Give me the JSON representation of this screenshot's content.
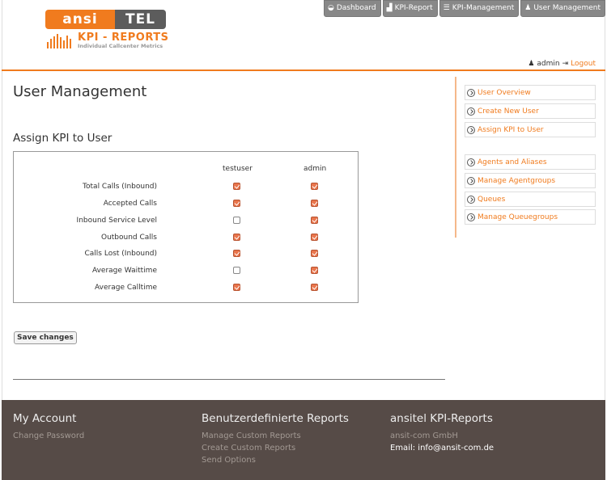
{
  "header": {
    "logo": {
      "ansi": "ansi",
      "tel": "TEL",
      "title": "KPI - REPORTS",
      "subtitle": "Individual Callcenter Metrics"
    },
    "nav": [
      {
        "label": "Dashboard",
        "icon": "dashboard-icon"
      },
      {
        "label": "KPI-Report",
        "icon": "bar-chart-icon"
      },
      {
        "label": "KPI-Management",
        "icon": "list-icon"
      },
      {
        "label": "User Management",
        "icon": "user-icon"
      }
    ],
    "user": {
      "name": "admin",
      "logout": "Logout"
    }
  },
  "main": {
    "title": "User Management",
    "section_title": "Assign KPI to User",
    "columns": [
      "testuser",
      "admin"
    ],
    "rows": [
      {
        "label": "Total Calls (Inbound)",
        "testuser": true,
        "admin": true
      },
      {
        "label": "Accepted Calls",
        "testuser": true,
        "admin": true
      },
      {
        "label": "Inbound Service Level",
        "testuser": false,
        "admin": true
      },
      {
        "label": "Outbound Calls",
        "testuser": true,
        "admin": true
      },
      {
        "label": "Calls Lost (Inbound)",
        "testuser": true,
        "admin": true
      },
      {
        "label": "Average Waittime",
        "testuser": false,
        "admin": true
      },
      {
        "label": "Average Calltime",
        "testuser": true,
        "admin": true
      }
    ],
    "save_label": "Save changes"
  },
  "sidebar": {
    "group1": [
      "User Overview",
      "Create New User",
      "Assign KPI to User"
    ],
    "group2": [
      "Agents and Aliases",
      "Manage Agentgroups",
      "Queues",
      "Manage Queuegroups"
    ]
  },
  "footer": {
    "col1": {
      "title": "My Account",
      "links": [
        "Change Password"
      ]
    },
    "col2": {
      "title": "Benutzerdefinierte Reports",
      "links": [
        "Manage Custom Reports",
        "Create Custom Reports",
        "Send Options"
      ]
    },
    "col3": {
      "title": "ansitel KPI-Reports",
      "company": "ansit-com GmbH",
      "email": "Email: info@ansit-com.de"
    }
  },
  "colors": {
    "accent": "#f07b1e",
    "footer_bg": "#564b47",
    "checkbox_on": "#e9764d"
  }
}
